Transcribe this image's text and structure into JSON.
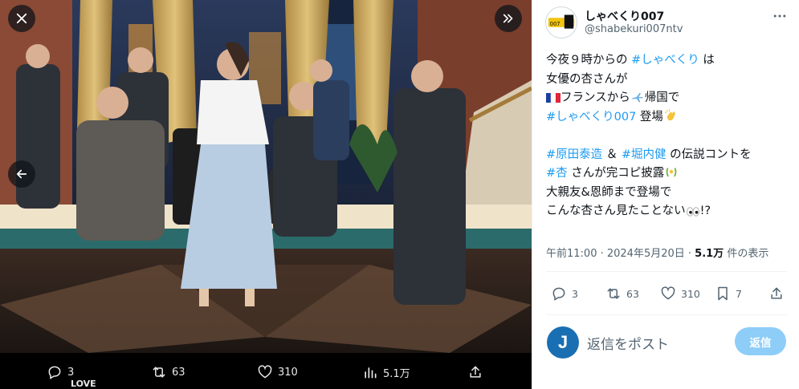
{
  "media": {
    "photo_alt": "",
    "actions": {
      "reply_count": "3",
      "retweet_count": "63",
      "like_count": "310",
      "view_count": "5.1万"
    },
    "reply_peek_name": "LOVE",
    "icons": [
      "close-icon",
      "expand-icon",
      "prev-arrow-icon",
      "reply-icon",
      "retweet-icon",
      "heart-icon",
      "views-icon",
      "share-icon"
    ]
  },
  "tweet": {
    "display_name": "しゃべくり007",
    "handle": "@shabekuri007ntv",
    "body": {
      "l1_pre": "今夜９時からの ",
      "l1_tag": "#しゃべくり",
      "l1_post": " は",
      "l2": "女優の杏さんが",
      "l3_a": "フランスから",
      "l3_b": "帰国で",
      "l4_tag": "#しゃべくり007",
      "l4_post": " 登場",
      "l5_tag1": "#原田泰造",
      "l5_mid": " ＆ ",
      "l5_tag2": "#堀内健",
      "l5_post": " の伝説コントを",
      "l6_tag": "#杏",
      "l6_post": " さんが完コピ披露",
      "l7": "大親友&恩師まで登場で",
      "l8_pre": "こんな杏さん見たことない",
      "l8_post": "!?"
    },
    "meta": {
      "time": "午前11:00 · 2024年5月20日 · ",
      "views": "5.1万",
      "views_suffix": " 件の表示"
    },
    "actions": {
      "reply_count": "3",
      "retweet_count": "63",
      "like_count": "310",
      "bookmark_count": "7"
    },
    "reply": {
      "avatar_letter": "J",
      "placeholder": "返信をポスト",
      "button_label": "返信"
    },
    "colors": {
      "link": "#1d9bf0",
      "muted": "#536471",
      "reply_button": "#8ecdf8"
    }
  }
}
